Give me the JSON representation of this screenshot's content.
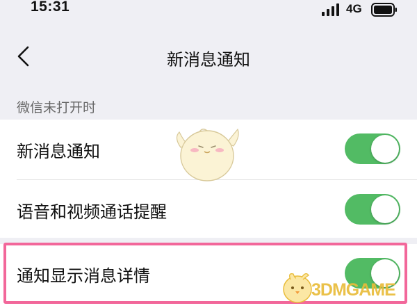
{
  "status_bar": {
    "time": "15:31",
    "network": "4G",
    "icons": [
      "signal-icon",
      "battery-icon"
    ]
  },
  "nav": {
    "back_icon": "chevron-left-icon",
    "title": "新消息通知"
  },
  "section": {
    "header": "微信未打开时"
  },
  "settings": [
    {
      "label": "新消息通知",
      "enabled": true
    },
    {
      "label": "语音和视频通话提醒",
      "enabled": true
    },
    {
      "label": "通知显示消息详情",
      "enabled": true,
      "highlighted": true
    }
  ],
  "watermark": {
    "text": "3DMGAME",
    "mascot_icon": "chick-mascot-icon"
  },
  "colors": {
    "page_background": "#efeff4",
    "toggle_on": "#52bb64",
    "highlight_border": "#f2679a",
    "watermark": "#e9bc3a"
  }
}
